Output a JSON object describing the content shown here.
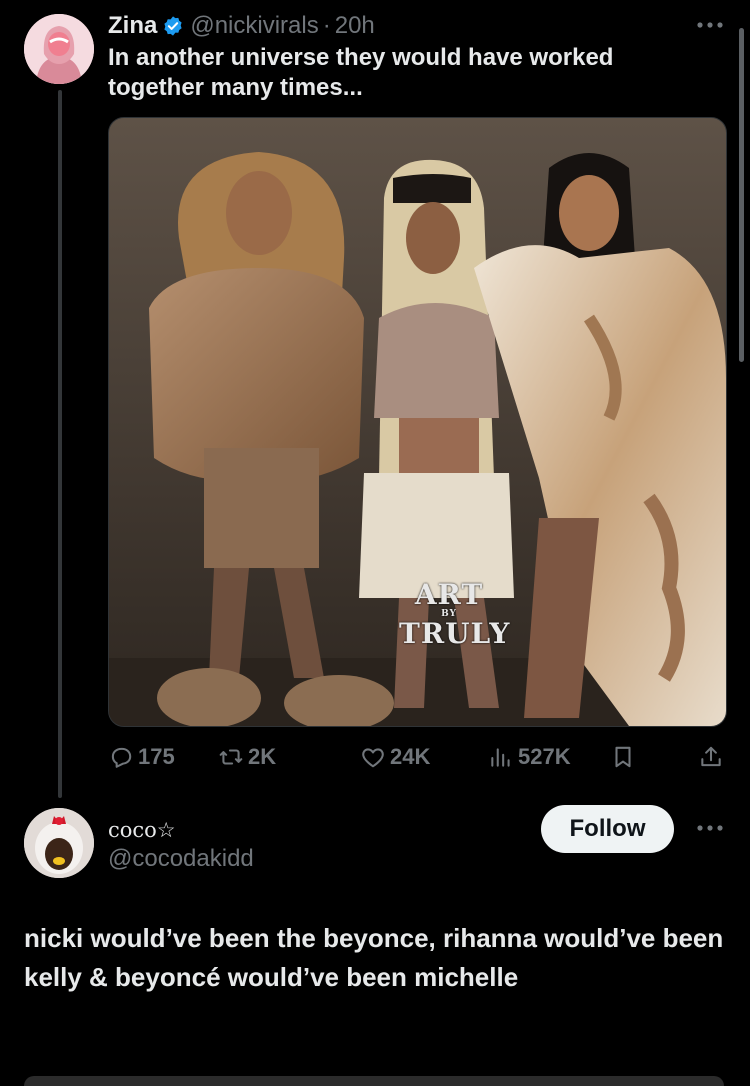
{
  "tweet": {
    "author_name": "Zina",
    "handle": "@nickivirals",
    "separator": "·",
    "time": "20h",
    "text": "In another universe they would have worked together many times...",
    "media": {
      "watermark_line1": "ART",
      "watermark_line2": "BY",
      "watermark_line3": "TRULY"
    },
    "actions": {
      "replies": "175",
      "reposts": "2K",
      "likes": "24K",
      "views": "527K"
    }
  },
  "reply": {
    "author_name": "coco☆",
    "handle": "@cocodakidd",
    "follow_label": "Follow",
    "text": "nicki would’ve been the beyonce, rihanna would’ve been kelly & beyoncé would’ve been michelle"
  },
  "colors": {
    "background": "#000000",
    "text_primary": "#e7e9ea",
    "text_secondary": "#71767b",
    "verified": "#1d9bf0"
  },
  "icons": {
    "verified": "verified-badge-icon",
    "more": "more-dots-icon",
    "reply": "reply-icon",
    "repost": "repost-icon",
    "like": "heart-icon",
    "views": "views-icon",
    "bookmark": "bookmark-icon",
    "share": "share-icon"
  }
}
